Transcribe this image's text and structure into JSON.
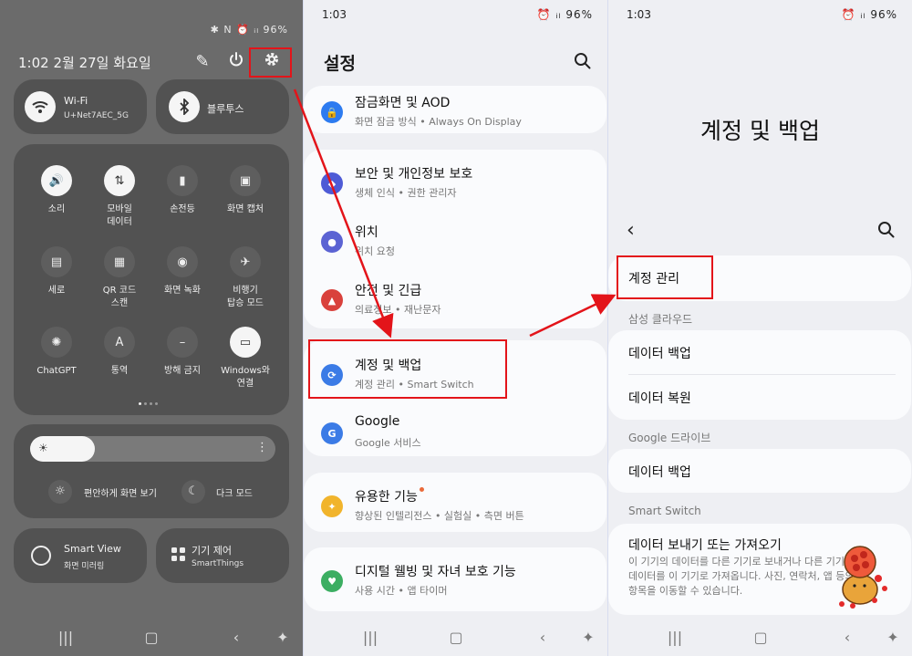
{
  "status_left": {
    "date_line": "1:02  2월 27일 화요일",
    "icons": "✱ N ⏰ ᵢₗ 96%"
  },
  "status_mid": {
    "time": "1:03",
    "icons": "⏰ ᵢₗ 96%"
  },
  "status_right": {
    "time": "1:03",
    "icons": "⏰ ᵢₗ 96%"
  },
  "quick_panel": {
    "wifi": {
      "title": "Wi-Fi",
      "sub": "U+Net7AEC_5G"
    },
    "bluetooth": {
      "title": "블루투스"
    },
    "tiles": [
      {
        "label": "소리"
      },
      {
        "label": "모바일\n데이터"
      },
      {
        "label": "손전등"
      },
      {
        "label": "화면 캡처"
      },
      {
        "label": "세로"
      },
      {
        "label": "QR 코드\n스캔"
      },
      {
        "label": "화면 녹화"
      },
      {
        "label": "비행기\n탑승 모드"
      },
      {
        "label": "ChatGPT"
      },
      {
        "label": "통역"
      },
      {
        "label": "방해 금지"
      },
      {
        "label": "Windows와\n연결"
      }
    ],
    "comfort": "편안하게 화면 보기",
    "dark": "다크 모드",
    "smart_view": {
      "title": "Smart View",
      "sub": "화면 미러링"
    },
    "device": {
      "title": "기기 제어",
      "sub": "SmartThings"
    }
  },
  "settings": {
    "title": "설정",
    "items": [
      {
        "title": "잠금화면 및 AOD",
        "sub": "화면 잠금 방식  •  Always On Display"
      },
      {
        "title": "보안 및 개인정보 보호",
        "sub": "생체 인식  •  권한 관리자"
      },
      {
        "title": "위치",
        "sub": "위치 요청"
      },
      {
        "title": "안전 및 긴급",
        "sub": "의료정보  •  재난문자"
      },
      {
        "title": "계정 및 백업",
        "sub": "계정 관리  •  Smart Switch"
      },
      {
        "title": "Google",
        "sub": "Google 서비스"
      },
      {
        "title": "유용한 기능",
        "sub": "향상된 인텔리전스  •  실험실  •  측면 버튼"
      },
      {
        "title": "디지털 웰빙 및 자녀 보호 기능",
        "sub": "사용 시간  •  앱 타이머"
      }
    ]
  },
  "accounts": {
    "title": "계정 및 백업",
    "account_manage": "계정 관리",
    "samsung_cloud": "삼성 클라우드",
    "data_backup": "데이터 백업",
    "data_restore": "데이터 복원",
    "google_drive": "Google 드라이브",
    "google_backup": "데이터 백업",
    "smart_switch": "Smart Switch",
    "transfer_title": "데이터 보내기 또는 가져오기",
    "transfer_desc": "이 기기의 데이터를 다른 기기로 보내거나 다른 기기의 데이터를 이 기기로 가져옵니다. 사진, 연락처, 앱 등의 항목을 이동할 수 있습니다."
  },
  "colors": {
    "highlight": "#e3141a",
    "lock_icon": "#2d7bf0",
    "security_icon": "#4e5bd6",
    "location_icon": "#5b63d3",
    "safety_icon": "#d9413c",
    "account_icon": "#3b7be6",
    "google_icon": "#3b7be6",
    "feature_icon": "#f1b42c",
    "wellbeing_icon": "#3cae62"
  }
}
